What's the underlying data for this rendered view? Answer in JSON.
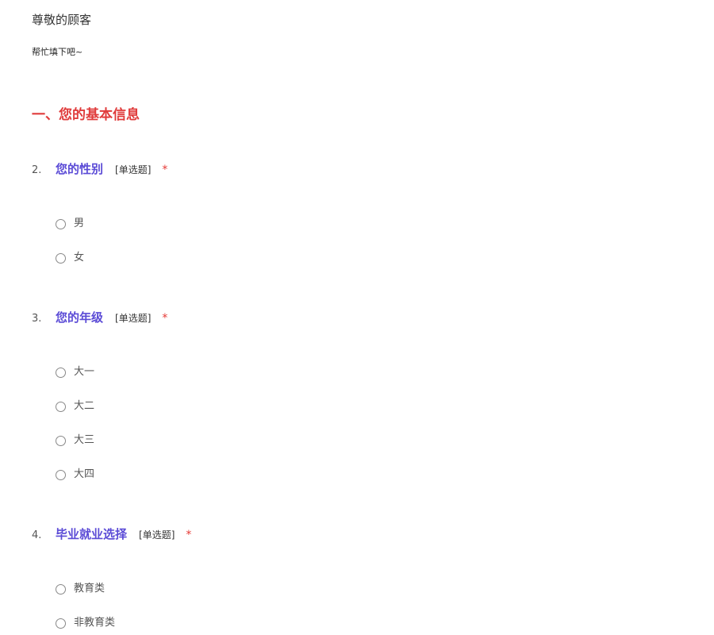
{
  "header": {
    "greeting": "尊敬的顾客",
    "subtitle": "帮忙填下吧~"
  },
  "section": {
    "title": "一、您的基本信息",
    "color": "#e03c3c"
  },
  "accent": {
    "question_title_color": "#5b4bd6",
    "required_color": "#e53935"
  },
  "questions": [
    {
      "number": "2.",
      "title": "您的性别",
      "type": "[单选题]",
      "required": "*",
      "options": [
        "男",
        "女"
      ]
    },
    {
      "number": "3.",
      "title": "您的年级",
      "type": "[单选题]",
      "required": "*",
      "options": [
        "大一",
        "大二",
        "大三",
        "大四"
      ]
    },
    {
      "number": "4.",
      "title": "毕业就业选择",
      "type": "[单选题]",
      "required": "*",
      "options": [
        "教育类",
        "非教育类"
      ]
    }
  ]
}
